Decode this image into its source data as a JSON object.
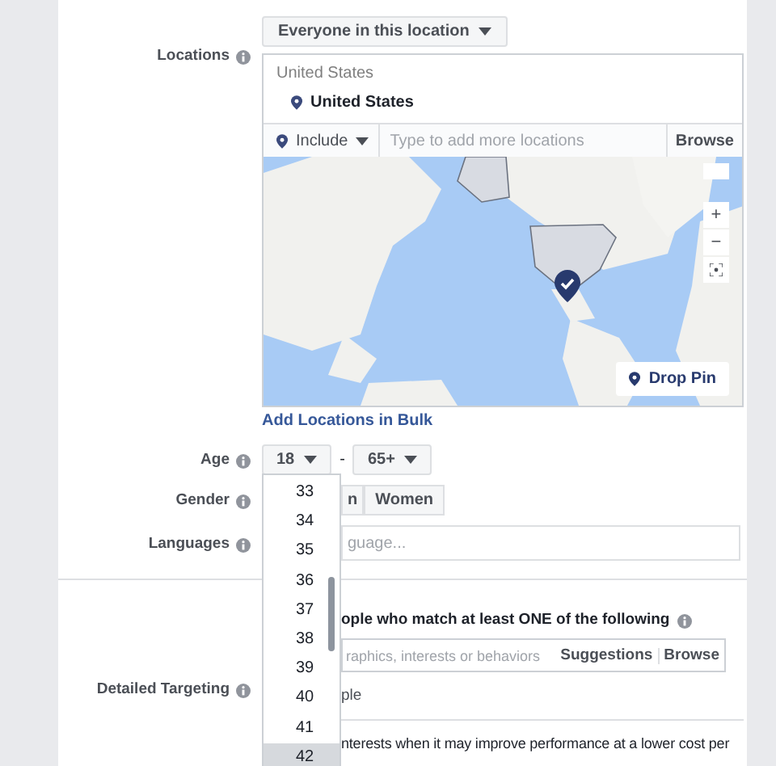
{
  "audience_button": {
    "label": "Everyone in this location"
  },
  "locations": {
    "label": "Locations",
    "selected_header": "United States",
    "selected_items": [
      {
        "name": "United States"
      }
    ],
    "include_dropdown": {
      "label": "Include"
    },
    "search": {
      "placeholder": "Type to add more locations"
    },
    "browse": "Browse",
    "map": {
      "kind": "picture",
      "zoom_in": "+",
      "zoom_out": "−",
      "drop_pin": "Drop Pin"
    },
    "bulk_link": "Add Locations in Bulk"
  },
  "age": {
    "label": "Age",
    "min": "18",
    "separator": "-",
    "max": "65+",
    "options": [
      {
        "label": "33",
        "selected": false
      },
      {
        "label": "34",
        "selected": false
      },
      {
        "label": "35",
        "selected": false
      },
      {
        "label": "36",
        "selected": false
      },
      {
        "label": "37",
        "selected": false
      },
      {
        "label": "38",
        "selected": false
      },
      {
        "label": "39",
        "selected": false
      },
      {
        "label": "40",
        "selected": false
      },
      {
        "label": "41",
        "selected": false
      },
      {
        "label": "42",
        "selected": true
      }
    ]
  },
  "gender": {
    "label": "Gender",
    "options": [
      {
        "label": "n",
        "selected": false
      },
      {
        "label": "Women",
        "selected": false
      }
    ]
  },
  "languages": {
    "label": "Languages",
    "placeholder": "guage..."
  },
  "detailed_targeting": {
    "label": "Detailed Targeting",
    "heading": "ople who match at least ONE of the following",
    "search": {
      "placeholder": "raphics, interests or behaviors"
    },
    "suggestions": "Suggestions",
    "browse": "Browse",
    "exclude_link": "ple",
    "expansion_text": "nterests when it may improve performance at a lower cost per"
  }
}
